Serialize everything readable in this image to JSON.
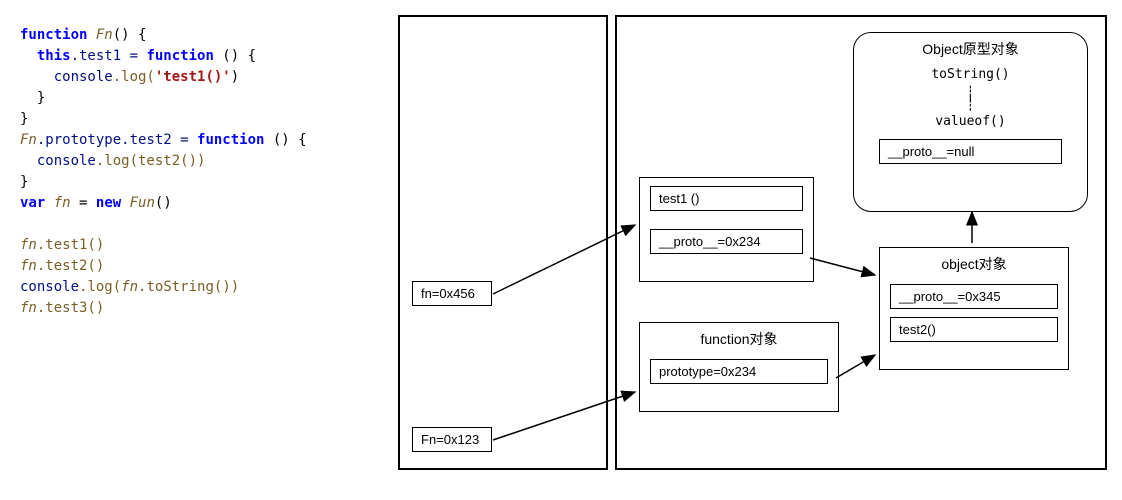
{
  "code": {
    "t0": "function",
    "t1": "Fn",
    "t2": "() {",
    "t3": "this",
    "t4": ".test1 = ",
    "t5": "function",
    "t6": " () {",
    "t7": "    console",
    "t8": ".log(",
    "t9": "'test1()'",
    "t10": ")",
    "t11": "  }",
    "t12": "}",
    "t13": "Fn",
    "t14": ".prototype.test2 = ",
    "t15": "function",
    "t16": " () {",
    "t17": "  console",
    "t18": ".log(test2())",
    "t19": "}",
    "t20": "var",
    "t21": " fn",
    "t22": " = ",
    "t23": "new",
    "t24": " Fun",
    "t25": "()",
    "t26": "fn",
    "t27": ".test1()",
    "t28": "fn",
    "t29": ".test2()",
    "t30": "console",
    "t31": ".log(",
    "t32": "fn",
    "t33": ".toString())",
    "t34": "fn",
    "t35": ".test3()"
  },
  "stack": {
    "fn": "fn=0x456",
    "Fn": "Fn=0x123"
  },
  "heap": {
    "instance": {
      "f1": "test1 ()",
      "f2": "__proto__=0x234"
    },
    "func": {
      "title": "function对象",
      "f1": "prototype=0x234"
    },
    "objproto": {
      "title": "Object原型对象",
      "f1": "toString()",
      "f2": "valueof()",
      "f3": "__proto__=null"
    },
    "obj": {
      "title": "object对象",
      "f1": "__proto__=0x345",
      "f2": "test2()"
    }
  }
}
